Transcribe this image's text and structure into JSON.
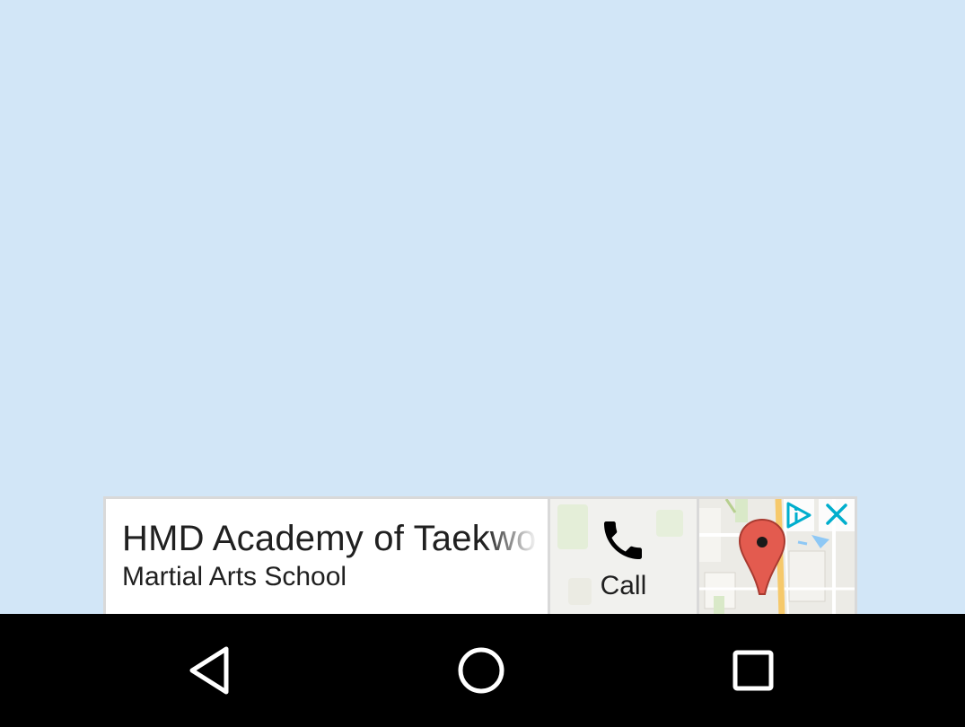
{
  "ad": {
    "title": "HMD Academy of Taekwondo",
    "subtitle": "Martial Arts School",
    "call_label": "Call",
    "icons": {
      "call": "phone-icon",
      "ad_choices": "ad-choices-icon",
      "close": "close-icon",
      "map_pin": "map-pin-icon"
    },
    "colors": {
      "accent": "#00aecd",
      "pin": "#e35b4f"
    }
  },
  "nav": {
    "back": "back-icon",
    "home": "home-icon",
    "recents": "recents-icon"
  }
}
